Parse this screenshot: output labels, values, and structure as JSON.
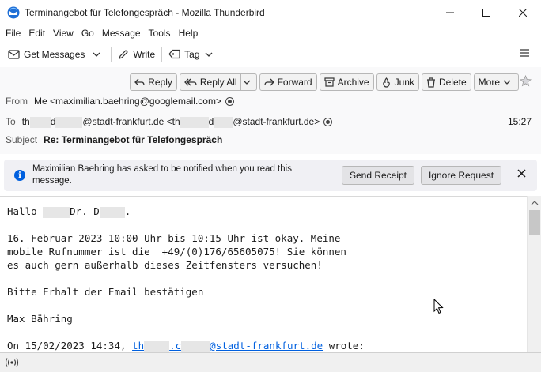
{
  "window": {
    "title": "Terminangebot für Telefongespräch - Mozilla Thunderbird"
  },
  "menu": [
    "File",
    "Edit",
    "View",
    "Go",
    "Message",
    "Tools",
    "Help"
  ],
  "toolbar": {
    "get_messages": "Get Messages",
    "write": "Write",
    "tag": "Tag"
  },
  "actions": {
    "reply": "Reply",
    "reply_all": "Reply All",
    "forward": "Forward",
    "archive": "Archive",
    "junk": "Junk",
    "delete": "Delete",
    "more": "More"
  },
  "header": {
    "from_label": "From",
    "from_value": "Me <maximilian.baehring@googlemail.com>",
    "to_label": "To",
    "to_part1": "th",
    "to_part2": "d",
    "to_part3": "@stadt-frankfurt.de <th",
    "to_part4": "d",
    "to_part5": "@stadt-frankfurt.de>",
    "time": "15:27",
    "subject_label": "Subject",
    "subject_value": "Re: Terminangebot für Telefongespräch"
  },
  "notification": {
    "text": "Maximilian Baehring has asked to be notified when you read this message.",
    "send_receipt": "Send Receipt",
    "ignore_request": "Ignore Request"
  },
  "body": {
    "greeting_a": "Hallo ",
    "greeting_b": "Dr. D",
    "greeting_c": ".",
    "line1": "16. Februar 2023 10:00 Uhr bis 10:15 Uhr ist okay. Meine",
    "line2": "mobile Rufnummer ist die  +49/(0)176/65605075! Sie können",
    "line3": "es auch gern außerhalb dieses Zeitfensters versuchen!",
    "line4": "Bitte Erhalt der Email bestätigen",
    "line5": "Max Bähring",
    "quote_prefix": "On 15/02/2023 14:34, ",
    "quote_link_a": "th",
    "quote_link_b": ".c",
    "quote_link_c": "@stadt-frankfurt.de",
    "quote_suffix": " wrote:"
  }
}
